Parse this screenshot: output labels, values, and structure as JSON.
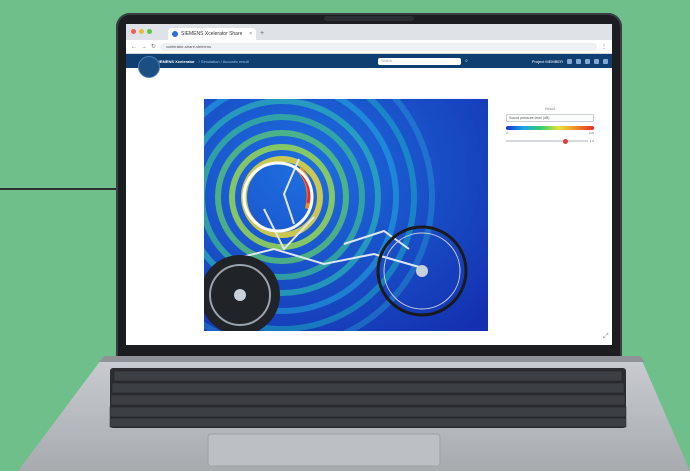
{
  "browser": {
    "tab_title": "SIEMENS Xcelerator Share",
    "tab_close": "×",
    "new_tab": "+",
    "url": "xcelerator-share.siemens",
    "nav_back": "←",
    "nav_forward": "→",
    "nav_reload": "↻",
    "menu": "⋮"
  },
  "app": {
    "brand": "SIEMENS Xcelerator",
    "breadcrumb": "/ Simulation / Acoustic result",
    "search_placeholder": "Search",
    "user": "Project MEMBER"
  },
  "panel": {
    "title": "Result",
    "selected_result": "Sound pressure level (dB)",
    "colorbar_min": "0",
    "colorbar_max": "100",
    "slider_value": "1.0"
  },
  "colors": {
    "background": "#6fbf8a",
    "app_header": "#0f3f71",
    "highlight_ring": "#ffffff"
  },
  "icons": {
    "fullscreen": "expand-icon",
    "search": "search-icon"
  }
}
